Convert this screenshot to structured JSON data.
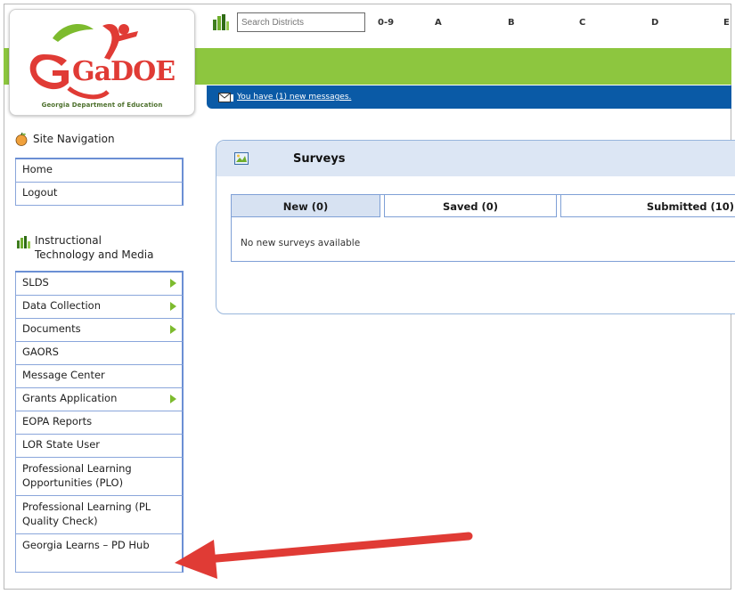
{
  "logo": {
    "main_text": "GaDOE",
    "subtitle": "Georgia Department of Education"
  },
  "topbar": {
    "search_placeholder": "Search Districts",
    "alpha_index": [
      "0-9",
      "A",
      "B",
      "C",
      "D",
      "E"
    ]
  },
  "messages": {
    "link_text": "You have (1) new messages."
  },
  "sidebar": {
    "site_nav_title": "Site Navigation",
    "site_nav_items": [
      {
        "label": "Home"
      },
      {
        "label": "Logout"
      }
    ],
    "section_title_line1": "Instructional",
    "section_title_line2": "Technology and Media",
    "section_items": [
      {
        "label": "SLDS",
        "has_arrow": true
      },
      {
        "label": "Data Collection",
        "has_arrow": true
      },
      {
        "label": "Documents",
        "has_arrow": true
      },
      {
        "label": "GAORS",
        "has_arrow": false
      },
      {
        "label": "Message Center",
        "has_arrow": false
      },
      {
        "label": "Grants Application",
        "has_arrow": true
      },
      {
        "label": "EOPA Reports",
        "has_arrow": false
      },
      {
        "label": "LOR State User",
        "has_arrow": false
      },
      {
        "label": "Professional Learning Opportunities (PLO)",
        "has_arrow": false
      },
      {
        "label": "Professional Learning (PL Quality Check)",
        "has_arrow": false
      },
      {
        "label": "Georgia Learns – PD Hub",
        "has_arrow": false
      }
    ]
  },
  "surveys": {
    "title": "Surveys",
    "tabs": [
      {
        "label": "New (0)",
        "active": true
      },
      {
        "label": "Saved (0)",
        "active": false
      },
      {
        "label": "Submitted (10)",
        "active": false
      }
    ],
    "empty_message": "No new surveys available"
  },
  "colors": {
    "green_band": "#8dc63f",
    "blue_band": "#0a5aa6",
    "nav_border": "#6b8fd4",
    "arrow_red": "#e03b35",
    "submenu_arrow": "#7dbb2e"
  },
  "icons": [
    "bar-chart-icon",
    "envelope-icon",
    "apple-icon",
    "survey-icon",
    "red-annotation-arrow"
  ]
}
